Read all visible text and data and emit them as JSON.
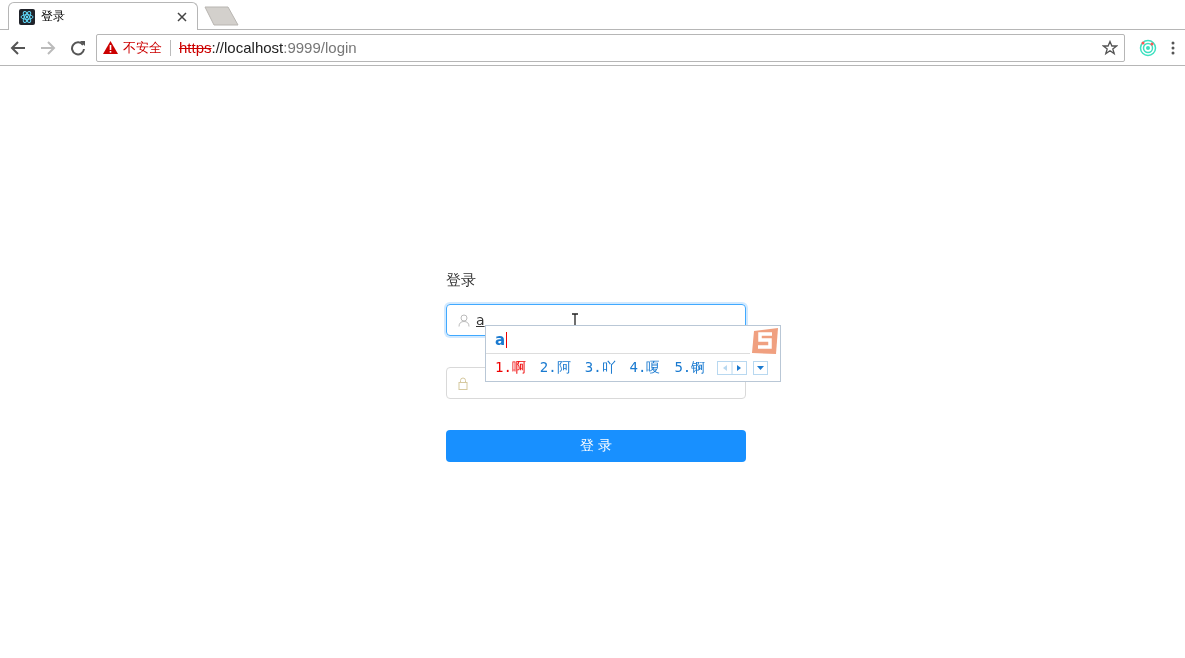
{
  "tabs": [
    {
      "title": "登录",
      "selected": true
    }
  ],
  "address_bar": {
    "security": "不安全",
    "scheme": "https",
    "host": "://localhost",
    "port": ":9999/login"
  },
  "login": {
    "title": "登录",
    "username": {
      "value": "a"
    },
    "submit": "登 录"
  },
  "ime": {
    "composition": "a",
    "candidates": [
      {
        "label": "1.啊",
        "selected": true
      },
      {
        "label": "2.阿",
        "selected": false
      },
      {
        "label": "3.吖",
        "selected": false
      },
      {
        "label": "4.嗄",
        "selected": false
      },
      {
        "label": "5.锕",
        "selected": false
      }
    ]
  }
}
